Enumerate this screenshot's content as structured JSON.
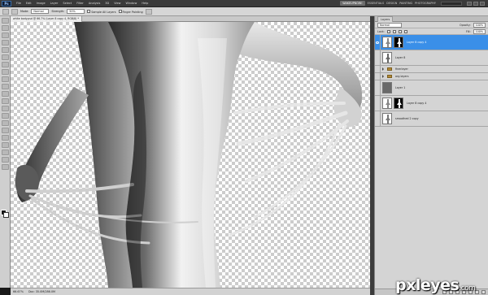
{
  "app": {
    "logo": "Ps",
    "menu": [
      "File",
      "Edit",
      "Image",
      "Layer",
      "Select",
      "Filter",
      "Analysis",
      "3D",
      "View",
      "Window",
      "Help"
    ],
    "workspaces": [
      "WAKEUPNOW!",
      "ESSENTIALS",
      "DESIGN",
      "PAINTING",
      "PHOTOGRAPHY"
    ],
    "active_workspace": "WAKEUPNOW!",
    "search_placeholder": "CS Live"
  },
  "options": {
    "mode_label": "Mode:",
    "mode_value": "Normal",
    "strength_label": "Strength:",
    "strength_value": "50%",
    "sample_all_layers": "Sample All Layers",
    "finger_painting": "Finger Painting"
  },
  "document": {
    "tab_title": "white body.psd @ 66.7% (Layer 8 copy 4, RGB/8) *"
  },
  "status": {
    "zoom": "66.67%",
    "doc_info": "Doc: 35.0M/286.0M"
  },
  "layers_panel": {
    "tab": "Layers",
    "blend_mode": "Normal",
    "opacity_label": "Opacity:",
    "opacity_value": "100%",
    "lock_label": "Lock:",
    "fill_label": "Fill:",
    "fill_value": "100%",
    "layers": [
      {
        "name": "Layer 8 copy 4",
        "kind": "masked",
        "selected": true
      },
      {
        "name": "Layer 8",
        "kind": "figure",
        "selected": false
      },
      {
        "name": "finerlayer",
        "kind": "group",
        "selected": false
      },
      {
        "name": "org layers",
        "kind": "group",
        "selected": false
      },
      {
        "name": "Layer 1",
        "kind": "fill",
        "selected": false
      },
      {
        "name": "Layer 8 copy 4",
        "kind": "masked",
        "selected": false
      },
      {
        "name": "smoothed 2 copy",
        "kind": "figure",
        "selected": false
      }
    ]
  },
  "watermark": {
    "name": "pxleyes",
    "ext": ".com"
  }
}
